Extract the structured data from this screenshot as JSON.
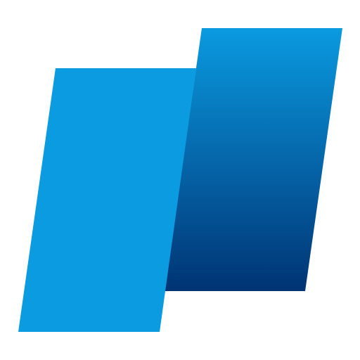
{
  "logo": {
    "icon": "two-parallelogram-logo-icon",
    "colors": {
      "front": "#0A9BE0",
      "back_top": "#0A9AE0",
      "back_bottom": "#003474",
      "background": "#FFFFFF"
    }
  }
}
